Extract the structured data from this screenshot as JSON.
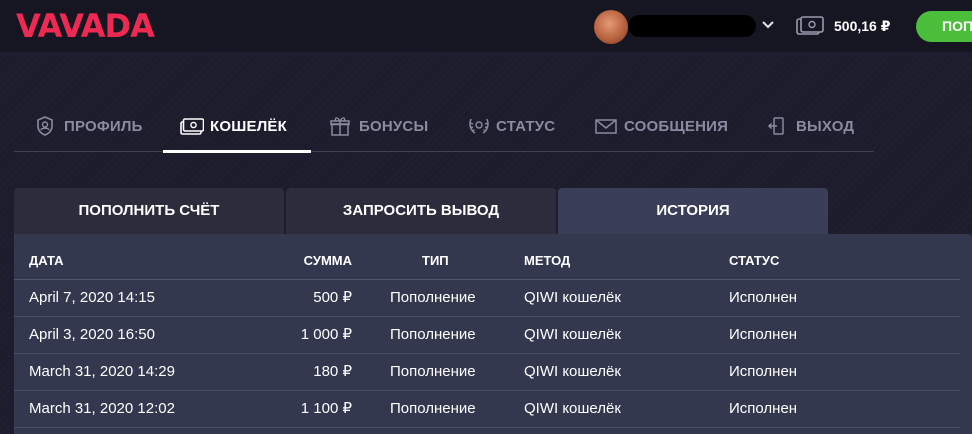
{
  "header": {
    "logo": "VAVADA",
    "balance": "500,16 ₽",
    "deposit_label": "ПОП"
  },
  "nav": {
    "items": [
      {
        "label": "ПРОФИЛЬ",
        "icon": "shield-user-icon",
        "active": false
      },
      {
        "label": "КОШЕЛЁК",
        "icon": "wallet-icon",
        "active": true
      },
      {
        "label": "БОНУСЫ",
        "icon": "gift-icon",
        "active": false
      },
      {
        "label": "СТАТУС",
        "icon": "laurel-icon",
        "active": false
      },
      {
        "label": "СООБЩЕНИЯ",
        "icon": "envelope-icon",
        "active": false
      },
      {
        "label": "ВЫХОД",
        "icon": "logout-icon",
        "active": false
      }
    ]
  },
  "wallet_tabs": [
    {
      "label": "ПОПОЛНИТЬ СЧЁТ",
      "active": false
    },
    {
      "label": "ЗАПРОСИТЬ ВЫВОД",
      "active": false
    },
    {
      "label": "ИСТОРИЯ",
      "active": true
    }
  ],
  "history": {
    "columns": [
      "ДАТА",
      "СУММА",
      "ТИП",
      "МЕТОД",
      "СТАТУС"
    ],
    "rows": [
      {
        "date": "April 7, 2020 14:15",
        "amount": "500 ₽",
        "type": "Пополнение",
        "method": "QIWI кошелёк",
        "status": "Исполнен"
      },
      {
        "date": "April 3, 2020 16:50",
        "amount": "1 000 ₽",
        "type": "Пополнение",
        "method": "QIWI кошелёк",
        "status": "Исполнен"
      },
      {
        "date": "March 31, 2020 14:29",
        "amount": "180 ₽",
        "type": "Пополнение",
        "method": "QIWI кошелёк",
        "status": "Исполнен"
      },
      {
        "date": "March 31, 2020 12:02",
        "amount": "1 100 ₽",
        "type": "Пополнение",
        "method": "QIWI кошелёк",
        "status": "Исполнен"
      }
    ]
  },
  "colors": {
    "brand": "#ee2a53",
    "accent_green": "#4bbf3b",
    "background": "#1c1c2c",
    "panel": "#34384f"
  }
}
